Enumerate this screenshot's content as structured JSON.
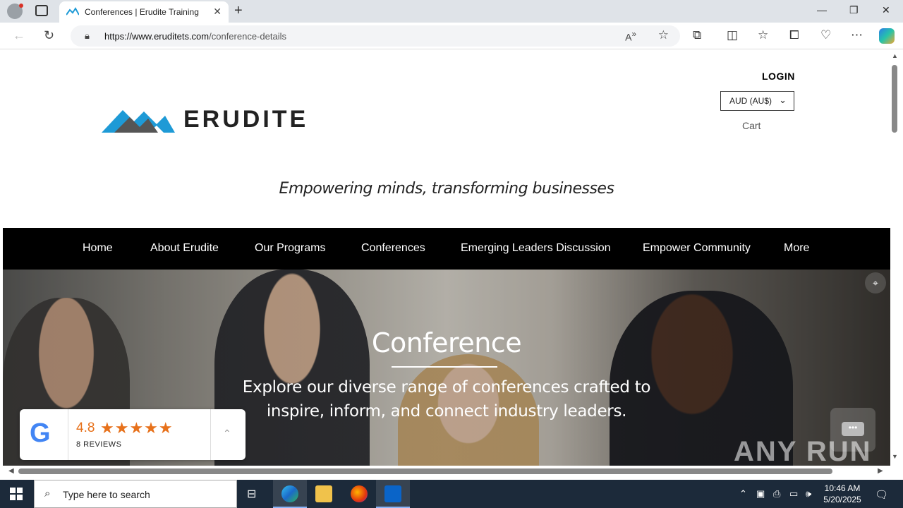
{
  "browser": {
    "tab_title": "Conferences | Erudite Training",
    "url_host": "https://www.eruditets.com",
    "url_path": "/conference-details",
    "new_tab_glyph": "+",
    "close_glyph": "✕"
  },
  "site": {
    "logo_text": "ERUDITE",
    "login_label": "LOGIN",
    "currency_selected": "AUD (AU$)",
    "cart_label": "Cart",
    "tagline": "Empowering minds, transforming businesses"
  },
  "nav": {
    "items": [
      {
        "label": "Home"
      },
      {
        "label": "About Erudite"
      },
      {
        "label": "Our Programs"
      },
      {
        "label": "Conferences"
      },
      {
        "label": "Emerging Leaders Discussion"
      },
      {
        "label": "Empower Community"
      },
      {
        "label": "More"
      }
    ]
  },
  "hero": {
    "title": "Conference",
    "subtitle": "Explore our diverse range of conferences crafted to inspire, inform, and connect industry leaders."
  },
  "reviews": {
    "rating": "4.8",
    "stars": "★★★★★",
    "count_label": "8 REVIEWS"
  },
  "watermark": "ANY RUN",
  "taskbar": {
    "search_placeholder": "Type here to search",
    "time": "10:46 AM",
    "date": "5/20/2025"
  },
  "colors": {
    "nav_background": "#000000",
    "logo_blue": "#1e9ad6",
    "star_orange": "#e7711b",
    "taskbar": "#1c2a3a"
  }
}
